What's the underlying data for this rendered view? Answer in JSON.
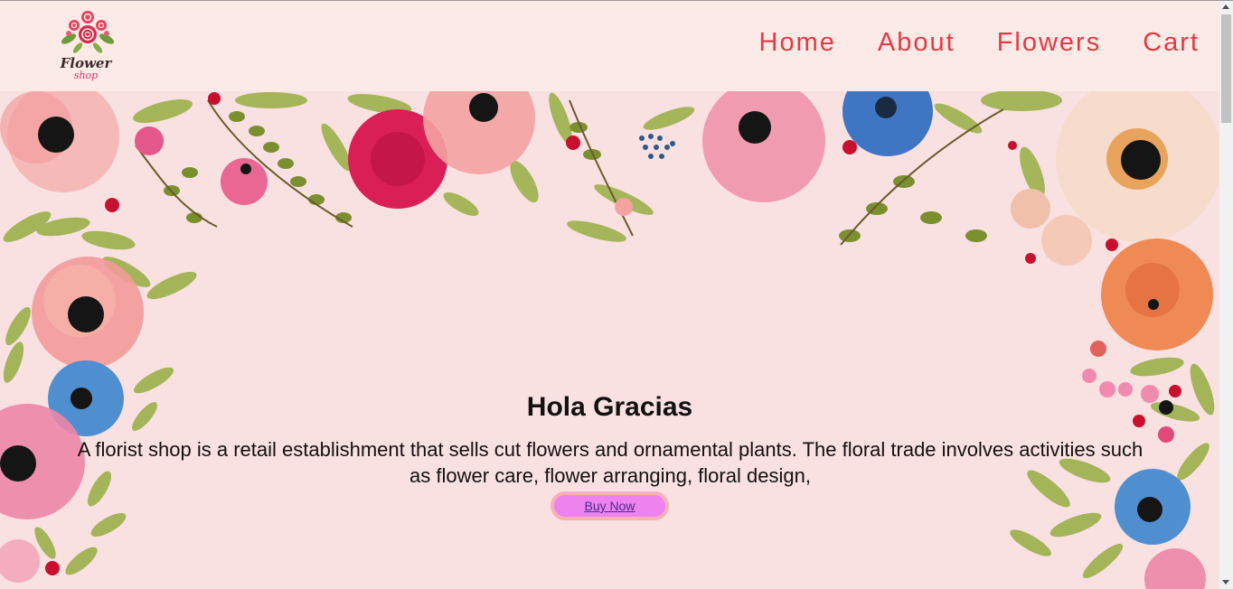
{
  "brand": {
    "logo_word": "Flower",
    "logo_sub": "shop"
  },
  "nav": {
    "items": [
      {
        "label": "Home"
      },
      {
        "label": "About"
      },
      {
        "label": "Flowers"
      },
      {
        "label": "Cart"
      }
    ]
  },
  "hero": {
    "title": "Hola Gracias",
    "text": "A florist shop is a retail establishment that sells cut flowers and ornamental plants. The floral trade involves activities such as flower care, flower arranging, floral design,",
    "button_label": "Buy Now"
  },
  "colors": {
    "header_bg": "#fbeae6",
    "hero_bg": "#f9e1e2",
    "nav_text": "#e23b45",
    "button_bg": "#ee82ee",
    "button_border": "#f7b0b8"
  },
  "icons": {
    "logo": "rose-bouquet-icon",
    "scroll_up": "chevron-up-icon",
    "scroll_down": "chevron-down-icon"
  }
}
